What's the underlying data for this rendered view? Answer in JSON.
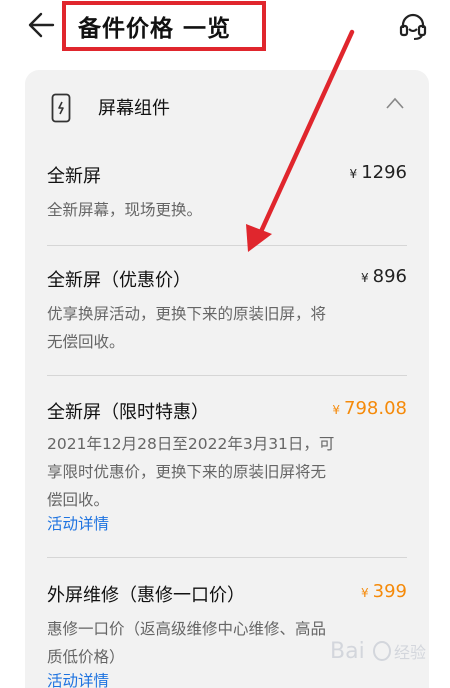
{
  "header": {
    "title": "备件价格 一览",
    "back_icon": "arrow-left-icon",
    "support_icon": "headset-icon"
  },
  "section": {
    "title": "屏幕组件",
    "icon": "phone-icon",
    "expanded": true
  },
  "items": [
    {
      "title": "全新屏",
      "currency": "¥",
      "price": "1296",
      "desc": "全新屏幕，现场更换。",
      "link": "",
      "promo": false
    },
    {
      "title": "全新屏（优惠价）",
      "currency": "¥",
      "price": "896",
      "desc": "优享换屏活动，更换下来的原装旧屏，将无偿回收。",
      "link": "",
      "promo": false
    },
    {
      "title": "全新屏（限时特惠）",
      "currency": "¥",
      "price": "798.08",
      "desc": "2021年12月28日至2022年3月31日，可享限时优惠价，更换下来的原装旧屏将无偿回收。",
      "link": "活动详情",
      "promo": true
    },
    {
      "title": "外屏维修（惠修一口价）",
      "currency": "¥",
      "price": "399",
      "desc": "惠修一口价（返高级维修中心维修、高品质低价格）",
      "link": "活动详情",
      "promo": true
    }
  ],
  "colors": {
    "annotation_red": "#e0262d",
    "promo_orange": "#f58a0a",
    "link_blue": "#1e73e0"
  }
}
